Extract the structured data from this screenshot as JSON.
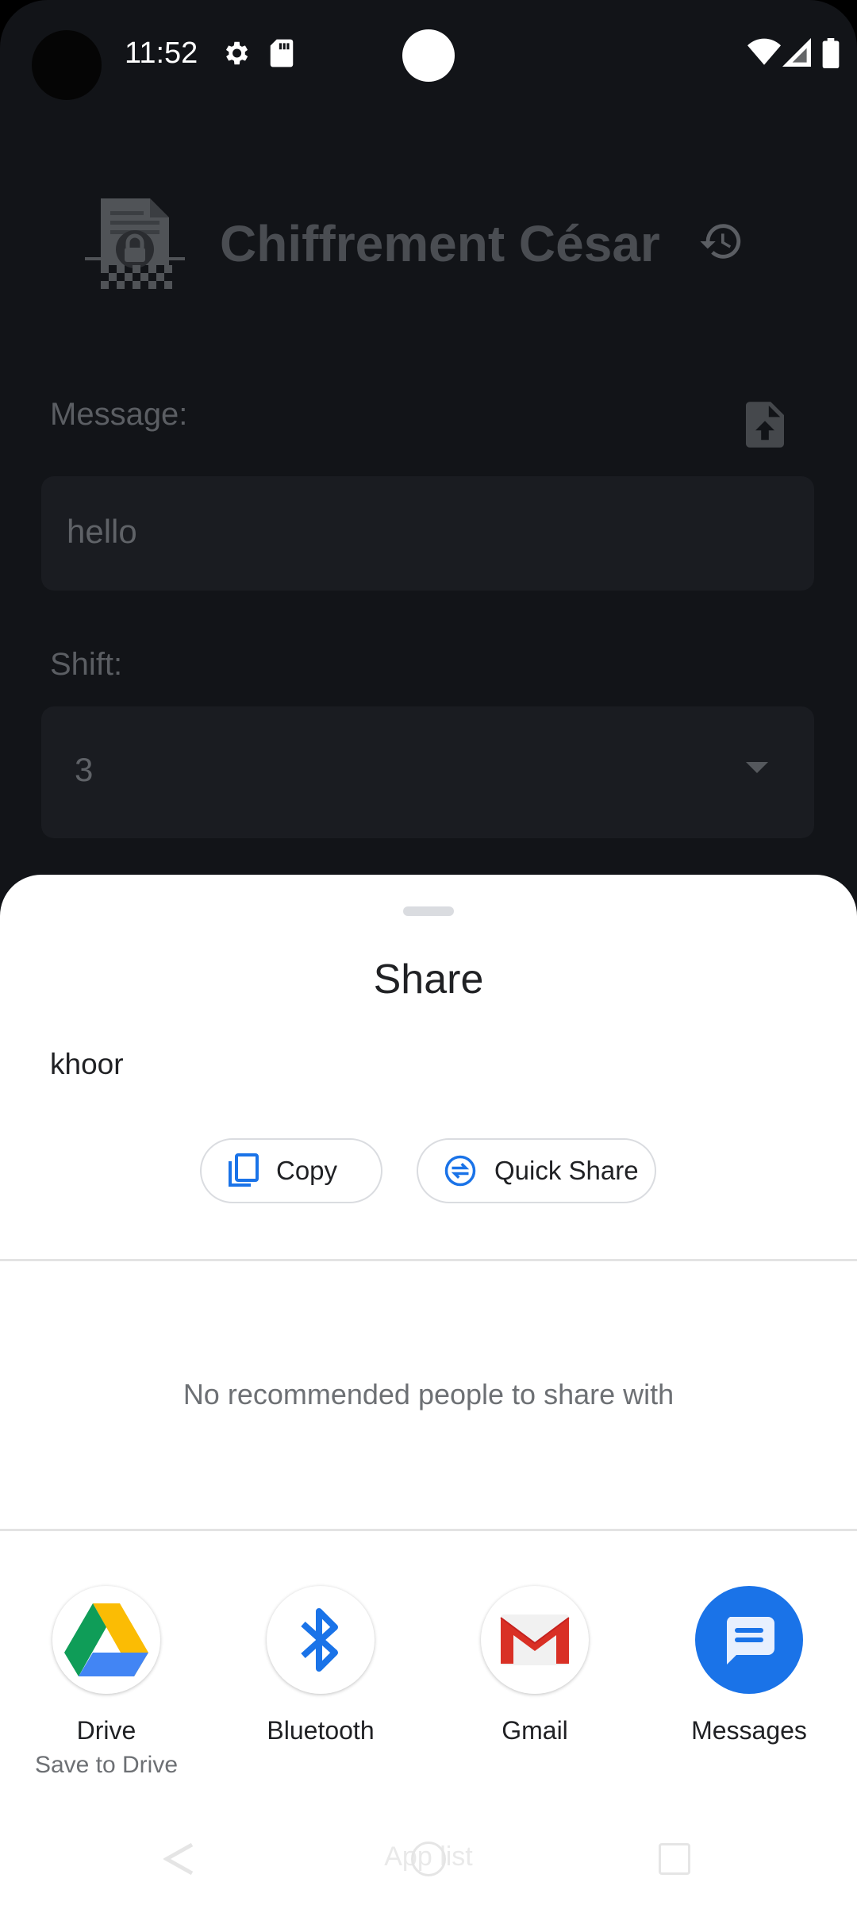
{
  "status_bar": {
    "time": "11:52"
  },
  "app": {
    "title": "Chiffrement César",
    "message_label": "Message:",
    "message_value": "hello",
    "shift_label": "Shift:",
    "shift_value": "3"
  },
  "share_sheet": {
    "title": "Share",
    "shared_text": "khoor",
    "actions": {
      "copy_label": "Copy",
      "quick_share_label": "Quick Share"
    },
    "no_people_text": "No recommended people to share with",
    "targets": [
      {
        "label": "Drive",
        "sublabel": "Save to Drive",
        "icon": "google-drive-icon"
      },
      {
        "label": "Bluetooth",
        "sublabel": "",
        "icon": "bluetooth-icon"
      },
      {
        "label": "Gmail",
        "sublabel": "",
        "icon": "gmail-icon"
      },
      {
        "label": "Messages",
        "sublabel": "",
        "icon": "messages-icon"
      }
    ]
  },
  "nav_bar": {
    "hint": "App list"
  },
  "colors": {
    "app_background": "#121418",
    "sheet_background": "#ffffff",
    "accent_blue": "#1a73e8"
  }
}
